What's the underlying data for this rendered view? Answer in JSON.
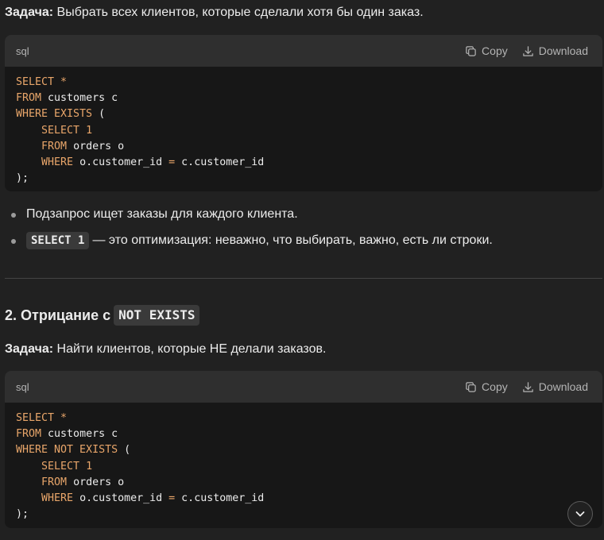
{
  "task1": {
    "label": "Задача:",
    "text": " Выбрать всех клиентов, которые сделали хотя бы один заказ."
  },
  "code1": {
    "lang": "sql",
    "copy_label": "Copy",
    "download_label": "Download",
    "lines": [
      [
        {
          "t": "SELECT *",
          "k": 1
        }
      ],
      [
        {
          "t": "FROM",
          "k": 1
        },
        {
          "t": " customers c"
        }
      ],
      [
        {
          "t": "WHERE EXISTS",
          "k": 1
        },
        {
          "t": " ("
        }
      ],
      [
        {
          "t": "    "
        },
        {
          "t": "SELECT 1",
          "k": 1
        }
      ],
      [
        {
          "t": "    "
        },
        {
          "t": "FROM",
          "k": 1
        },
        {
          "t": " orders o"
        }
      ],
      [
        {
          "t": "    "
        },
        {
          "t": "WHERE",
          "k": 1
        },
        {
          "t": " o.customer_id "
        },
        {
          "t": "=",
          "k": 1
        },
        {
          "t": " c.customer_id"
        }
      ],
      [
        {
          "t": ");"
        }
      ]
    ]
  },
  "bullets": {
    "item1": "Подзапрос ищет заказы для каждого клиента.",
    "item2_code": "SELECT 1",
    "item2_text": "— это оптимизация: неважно, что выбирать, важно, есть ли строки."
  },
  "heading2": {
    "text": "2. Отрицание с",
    "code": "NOT EXISTS"
  },
  "task2": {
    "label": "Задача:",
    "text": " Найти клиентов, которые НЕ делали заказов."
  },
  "code2": {
    "lang": "sql",
    "copy_label": "Copy",
    "download_label": "Download",
    "lines": [
      [
        {
          "t": "SELECT *",
          "k": 1
        }
      ],
      [
        {
          "t": "FROM",
          "k": 1
        },
        {
          "t": " customers c"
        }
      ],
      [
        {
          "t": "WHERE NOT EXISTS",
          "k": 1
        },
        {
          "t": " ("
        }
      ],
      [
        {
          "t": "    "
        },
        {
          "t": "SELECT 1",
          "k": 1
        }
      ],
      [
        {
          "t": "    "
        },
        {
          "t": "FROM",
          "k": 1
        },
        {
          "t": " orders o"
        }
      ],
      [
        {
          "t": "    "
        },
        {
          "t": "WHERE",
          "k": 1
        },
        {
          "t": " o.customer_id "
        },
        {
          "t": "=",
          "k": 1
        },
        {
          "t": " c.customer_id"
        }
      ],
      [
        {
          "t": ");"
        }
      ]
    ]
  },
  "colors": {
    "background": "#212121",
    "code_bg": "#171717",
    "code_header": "#2f2f2f",
    "keyword": "#e9a66a"
  },
  "icons": {
    "copy": "copy-icon",
    "download": "download-icon",
    "scroll": "chevron-down-icon"
  }
}
